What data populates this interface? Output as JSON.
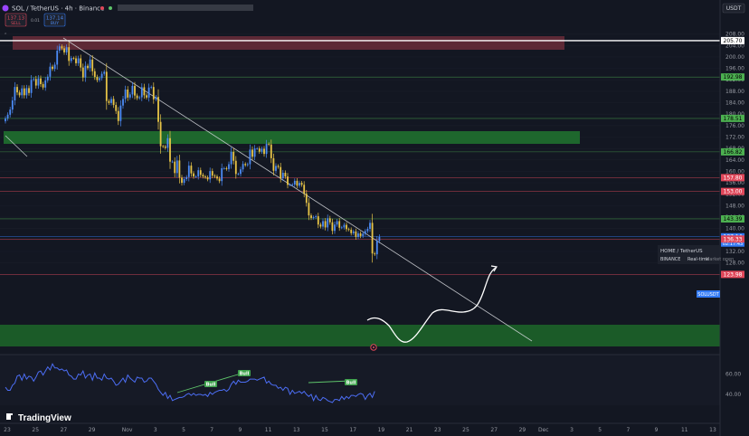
{
  "header": {
    "symbol_line": "SOL / TetherUS · 4h · Binance",
    "sell_price": "137.13",
    "sell_label": "SELL",
    "spread": "0.01",
    "buy_price": "137.14",
    "buy_label": "BUY",
    "currency": "USDT"
  },
  "colors": {
    "background": "#131722",
    "bull": "#4c8bf5",
    "bear": "#e8c547",
    "support_zone": "#1f6b2e",
    "resistance_zone": "#6b2d3a",
    "red_line": "#c23b4a",
    "green_line": "#2e6b3f",
    "rsi_line": "#4c6ef5"
  },
  "levels": [
    {
      "value": "205.70",
      "color": "#ffffff",
      "text_color": "#000000"
    },
    {
      "value": "192.98",
      "color": "#4caf50",
      "text_color": "#000000"
    },
    {
      "value": "178.51",
      "color": "#4caf50",
      "text_color": "#000000"
    },
    {
      "value": "166.82",
      "color": "#4caf50",
      "text_color": "#000000"
    },
    {
      "value": "157.80",
      "color": "#e0475a",
      "text_color": "#ffffff"
    },
    {
      "value": "153.00",
      "color": "#e0475a",
      "text_color": "#ffffff"
    },
    {
      "value": "143.39",
      "color": "#4caf50",
      "text_color": "#000000"
    },
    {
      "value": "137.14",
      "color": "#3179f5",
      "text_color": "#ffffff"
    },
    {
      "value": "136.33",
      "color": "#e0475a",
      "text_color": "#ffffff"
    },
    {
      "value": "123.98",
      "color": "#e0475a",
      "text_color": "#ffffff"
    }
  ],
  "current_price_sublabel": "02:17:43",
  "symbol_tag": "SOLUSDT",
  "info_box": {
    "line1": "HOME / TetherUS",
    "line2_a": "BINANCE",
    "line2_b": "Real-time",
    "line2_c": "Market open"
  },
  "bull_labels": [
    "Bull",
    "Bull",
    "Bull"
  ],
  "logo_text": "TradingView",
  "chart_data": {
    "type": "candlestick",
    "title": "SOL / TetherUS · 4h · Binance",
    "xlabel": "",
    "ylabel": "",
    "ylim": [
      121,
      210
    ],
    "y_ticks": [
      124.0,
      128.0,
      132.0,
      136.0,
      140.0,
      144.0,
      148.0,
      152.0,
      156.0,
      160.0,
      164.0,
      168.0,
      172.0,
      176.0,
      180.0,
      184.0,
      188.0,
      192.0,
      196.0,
      200.0,
      204.0,
      208.0
    ],
    "x_ticks": [
      {
        "label": "23",
        "i": 0
      },
      {
        "label": "25",
        "i": 12
      },
      {
        "label": "27",
        "i": 24
      },
      {
        "label": "29",
        "i": 36
      },
      {
        "label": "Nov",
        "i": 51
      },
      {
        "label": "3",
        "i": 63
      },
      {
        "label": "5",
        "i": 75
      },
      {
        "label": "7",
        "i": 87
      },
      {
        "label": "9",
        "i": 99
      },
      {
        "label": "11",
        "i": 111
      },
      {
        "label": "13",
        "i": 123
      },
      {
        "label": "15",
        "i": 135
      },
      {
        "label": "17",
        "i": 147
      },
      {
        "label": "19",
        "i": 159
      },
      {
        "label": "21",
        "i": 171
      },
      {
        "label": "23",
        "i": 183
      },
      {
        "label": "25",
        "i": 195
      },
      {
        "label": "27",
        "i": 207
      },
      {
        "label": "29",
        "i": 219
      },
      {
        "label": "Dec",
        "i": 228
      },
      {
        "label": "3",
        "i": 240
      },
      {
        "label": "5",
        "i": 252
      },
      {
        "label": "7",
        "i": 264
      },
      {
        "label": "9",
        "i": 276
      },
      {
        "label": "11",
        "i": 288
      },
      {
        "label": "13",
        "i": 300
      }
    ],
    "close": [
      178.5,
      179.8,
      181.6,
      184.8,
      189.5,
      187.6,
      186.6,
      189.0,
      186.6,
      189.1,
      187.4,
      192.0,
      192.3,
      190.0,
      192.5,
      190.5,
      189.3,
      191.8,
      193.1,
      196.6,
      195.8,
      197.3,
      202.2,
      203.7,
      203.0,
      201.6,
      203.4,
      198.6,
      199.6,
      199.5,
      197.8,
      199.5,
      196.3,
      192.8,
      196.9,
      196.1,
      199.1,
      195.0,
      193.0,
      191.9,
      192.6,
      194.1,
      194.8,
      184.6,
      183.9,
      185.3,
      183.2,
      181.1,
      177.6,
      183.0,
      185.3,
      188.6,
      185.8,
      186.9,
      189.9,
      186.5,
      185.6,
      185.9,
      189.4,
      186.6,
      185.8,
      189.3,
      189.5,
      185.2,
      186.0,
      177.3,
      168.8,
      168.7,
      168.2,
      171.6,
      163.4,
      163.4,
      159.4,
      163.8,
      157.8,
      156.0,
      157.3,
      158.0,
      162.0,
      159.3,
      158.2,
      158.2,
      160.4,
      158.8,
      158.2,
      157.9,
      157.2,
      160.1,
      158.5,
      158.2,
      157.5,
      156.6,
      161.1,
      161.1,
      160.8,
      162.5,
      166.8,
      163.7,
      159.1,
      159.1,
      160.7,
      162.6,
      162.2,
      162.5,
      167.6,
      165.1,
      168.0,
      168.0,
      166.9,
      167.9,
      166.1,
      169.6,
      169.4,
      164.6,
      160.2,
      161.9,
      161.5,
      157.6,
      159.5,
      158.2,
      155.3,
      155.3,
      155.4,
      156.7,
      155.0,
      156.0,
      155.3,
      152.2,
      149.0,
      144.6,
      143.7,
      144.0,
      144.3,
      141.4,
      140.7,
      142.6,
      140.4,
      143.6,
      142.2,
      139.2,
      141.4,
      142.6,
      140.3,
      140.4,
      141.3,
      139.8,
      139.6,
      138.4,
      139.0,
      137.1,
      138.3,
      137.4,
      138.2,
      139.1,
      139.9,
      142.0,
      131.3,
      131.0,
      135.7,
      137.1
    ]
  },
  "rsi_data": {
    "ylim": [
      15,
      75
    ],
    "y_ticks": [
      60.0,
      40.0
    ],
    "values": [
      47,
      44,
      44,
      49,
      51,
      58,
      59,
      54,
      60,
      55,
      58,
      57,
      53,
      57,
      62,
      63,
      59,
      63,
      67,
      64,
      70,
      66,
      66,
      64,
      65,
      63,
      64,
      59,
      58,
      55,
      55,
      60,
      59,
      63,
      56,
      59,
      60,
      54,
      61,
      56,
      56,
      54,
      60,
      56,
      55,
      56,
      53,
      49,
      50,
      53,
      56,
      52,
      59,
      56,
      54,
      52,
      57,
      56,
      56,
      52,
      53,
      56,
      56,
      53,
      50,
      45,
      42,
      39,
      42,
      36,
      39,
      34,
      35,
      36,
      37,
      37,
      38,
      40,
      41,
      39,
      41,
      39,
      40,
      40,
      39,
      40,
      38,
      42,
      40,
      42,
      43,
      44,
      44,
      45,
      43,
      45,
      50,
      53,
      50,
      54,
      52,
      52,
      52,
      53,
      55,
      55,
      55,
      54,
      55,
      56,
      57,
      51,
      53,
      50,
      49,
      49,
      46,
      47,
      44,
      47,
      46,
      40,
      44,
      41,
      42,
      43,
      41,
      43,
      40,
      38,
      40,
      34,
      39,
      35,
      34,
      37,
      36,
      34,
      33,
      32,
      35,
      35,
      34,
      38,
      35,
      38,
      36,
      39,
      39,
      38,
      40,
      41,
      40,
      35,
      39,
      41,
      37,
      43
    ]
  }
}
